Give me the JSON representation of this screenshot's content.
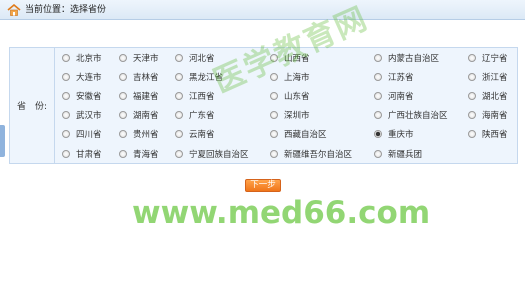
{
  "header": {
    "location": "当前位置：选择省份",
    "icon": "home-icon"
  },
  "form": {
    "label": "省　份:",
    "selected": "重庆市",
    "rows": [
      [
        "北京市",
        "天津市",
        "河北省",
        "山西省",
        "内蒙古自治区",
        "辽宁省"
      ],
      [
        "大连市",
        "吉林省",
        "黑龙江省",
        "上海市",
        "江苏省",
        "浙江省"
      ],
      [
        "安徽省",
        "福建省",
        "江西省",
        "山东省",
        "河南省",
        "湖北省"
      ],
      [
        "武汉市",
        "湖南省",
        "广东省",
        "深圳市",
        "广西壮族自治区",
        "海南省"
      ],
      [
        "四川省",
        "贵州省",
        "云南省",
        "西藏自治区",
        "重庆市",
        "陕西省"
      ],
      [
        "甘肃省",
        "青海省",
        "宁夏回族自治区",
        "新疆维吾尔自治区",
        "新疆兵团"
      ]
    ]
  },
  "buttons": {
    "next": "下一步"
  },
  "watermark": {
    "text": "医学教育网",
    "url": "www.med66.com"
  },
  "colors": {
    "accent": "#f0761a",
    "panel_bg": "#eef5fd",
    "border": "#c5d8ee",
    "watermark": "#6cc846"
  }
}
